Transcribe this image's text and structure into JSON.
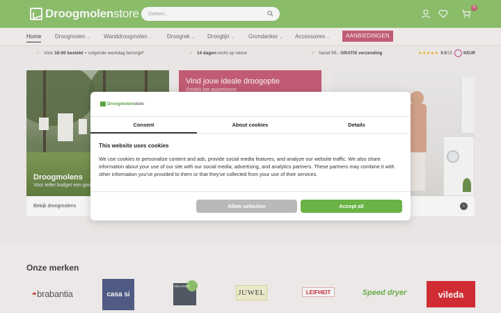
{
  "header": {
    "logo_bold": "Droogmolen",
    "logo_light": "store",
    "search_placeholder": "Zoeken..",
    "cart_count": "0"
  },
  "nav": {
    "items": [
      {
        "label": "Home"
      },
      {
        "label": "Droogmolen"
      },
      {
        "label": "Wanddroogmolen"
      },
      {
        "label": "Droogrek"
      },
      {
        "label": "Drooglijn"
      },
      {
        "label": "Grondanker"
      },
      {
        "label": "Accessoires"
      }
    ],
    "promo": "AANBIEDINGEN"
  },
  "usp": {
    "u1_bold": "16:00 besteld",
    "u1_pre": "Voor ",
    "u1_post": " = volgende werkdag bezorgd*",
    "u2_bold": "14 dagen",
    "u2_post": " recht op retour",
    "u3_pre": "Vanaf 99,- ",
    "u3_bold": "GRATIS verzending",
    "rating": "9.9",
    "rating_max": "/10",
    "keur": "KEUR"
  },
  "cards": {
    "c1_title": "Droogmolens",
    "c1_sub": "Voor ieder budget een geschikte",
    "c1_link": "Bekijk droogmolens",
    "c2_title": "Vind jouw ideale droogoptie",
    "c2_sub": "Ontdek het assortiment"
  },
  "cookie": {
    "logo_bold": "Droogmolen",
    "logo_light": "store",
    "tabs": [
      "Consent",
      "About cookies",
      "Details"
    ],
    "title": "This website uses cookies",
    "body": "We use cookies to personalize content and ads, provide social media features, and analyze our website traffic. We also share information about your use of our site with our social media, advertising, and analytics partners. These partners may combine it with other information you've provided to them or that they've collected from your use of their services.",
    "allow_selection": "Allow selection",
    "accept_all": "Accept all"
  },
  "brands": {
    "title": "Onze merken",
    "items": [
      "brabantia",
      "casa si",
      "HELCOSIS",
      "JUWEL",
      "LEIFHEIT",
      "Speed dryer",
      "vileda"
    ]
  },
  "colors": {
    "brand_green": "#8cc36a",
    "accent_pink": "#c85a75",
    "accept_green": "#6ab344"
  }
}
